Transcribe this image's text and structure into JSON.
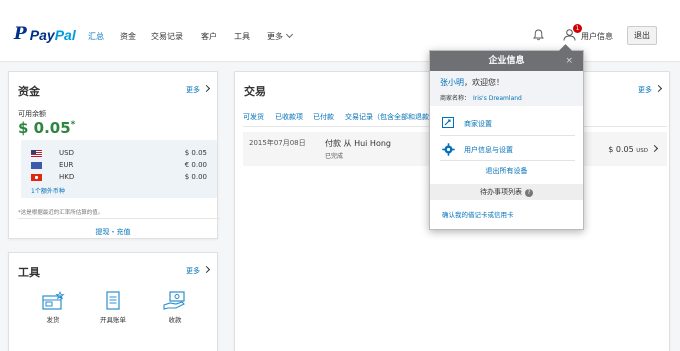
{
  "header": {
    "logo_pay": "Pay",
    "logo_pal": "Pal",
    "nav": [
      "汇总",
      "资金",
      "交易记录",
      "客户",
      "工具",
      "更多"
    ],
    "notification_badge": "1",
    "user_label": "用户信息",
    "logout_label": "退出"
  },
  "funds": {
    "title": "资金",
    "more": "更多",
    "available_label": "可用余额",
    "available_amount": "$ 0.05",
    "available_mark": "*",
    "currencies": [
      {
        "code": "USD",
        "amount": "$ 0.05"
      },
      {
        "code": "EUR",
        "amount": "€ 0.00"
      },
      {
        "code": "HKD",
        "amount": "$ 0.00"
      }
    ],
    "more_currencies": "1个额外币种",
    "note": "*这是根据最近的汇率所估算的值。",
    "withdraw": "提现・充值"
  },
  "tools": {
    "title": "工具",
    "more": "更多",
    "items": [
      {
        "label": "发货",
        "icon": "shipping-icon"
      },
      {
        "label": "开具账单",
        "icon": "invoice-icon"
      },
      {
        "label": "收款",
        "icon": "payment-icon"
      }
    ]
  },
  "transactions": {
    "title": "交易",
    "more": "更多",
    "tabs": [
      "可发货",
      "已收款项",
      "已付款",
      "交易记录（包含全部和退款）"
    ],
    "rows": [
      {
        "date": "2015年07月08日",
        "title": "付款 从 Hui Hong",
        "status": "已完成",
        "amount": "$ 0.05",
        "currency": "USD"
      }
    ]
  },
  "popup": {
    "title": "企业信息",
    "close": "×",
    "user_name": "张小明",
    "welcome_suffix": "，欢迎您！",
    "merchant_label": "商家名称：",
    "merchant_name": "Iris's Dreamland",
    "merchant_settings": "商家设置",
    "user_settings": "用户信息与设置",
    "signout_all": "退出所有设备",
    "todo": "待办事项列表",
    "confirm_card": "确认我的借记卡或信用卡"
  },
  "colors": {
    "brand_dark": "#003087",
    "brand_light": "#009cde",
    "link": "#0070ba",
    "balance": "#2e8540",
    "badge": "#d20000"
  }
}
